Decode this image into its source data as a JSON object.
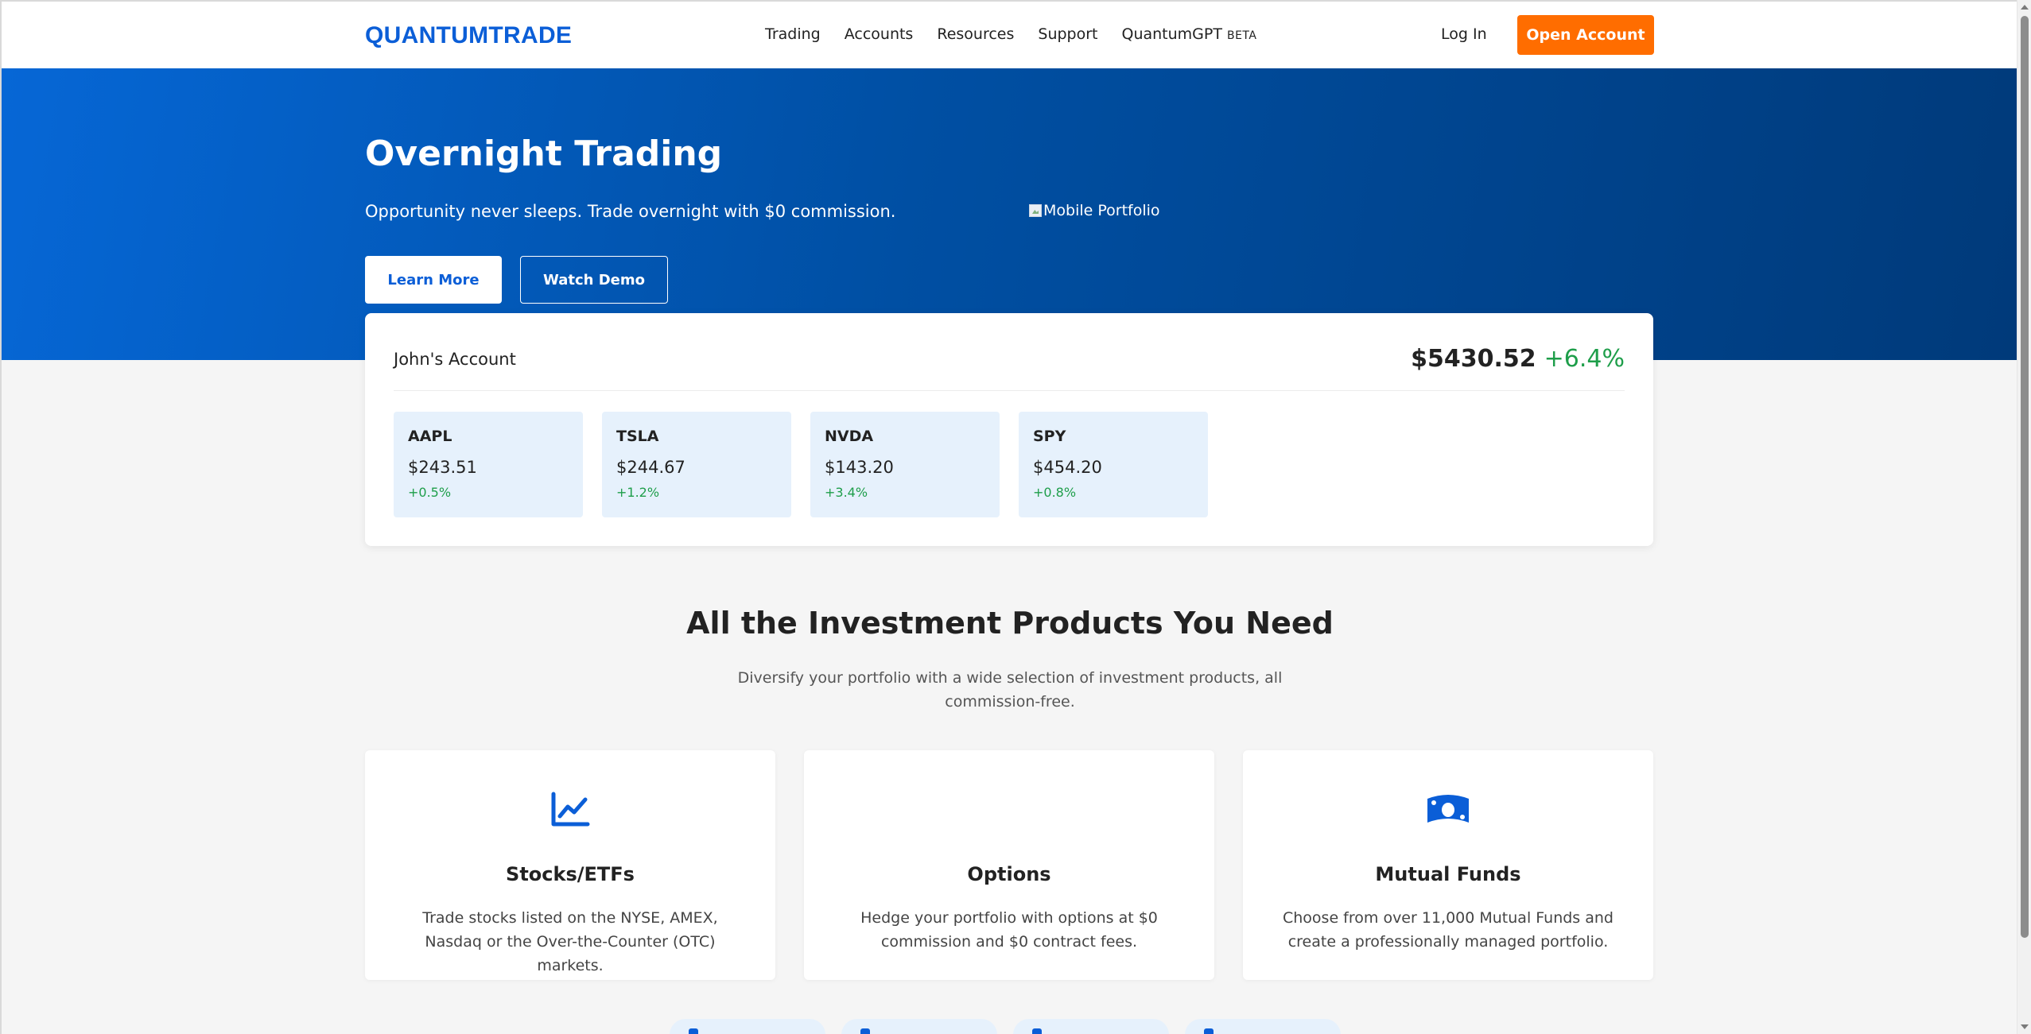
{
  "header": {
    "logo": "QUANTUMTRADE",
    "nav": [
      {
        "label": "Trading"
      },
      {
        "label": "Accounts"
      },
      {
        "label": "Resources"
      },
      {
        "label": "Support"
      },
      {
        "label": "QuantumGPT",
        "badge": "BETA"
      }
    ],
    "login_label": "Log In",
    "open_account_label": "Open Account"
  },
  "hero": {
    "title": "Overnight Trading",
    "subtitle": "Opportunity never sleeps. Trade overnight with $0 commission.",
    "learn_more_label": "Learn More",
    "watch_demo_label": "Watch Demo",
    "image_alt": "Mobile Portfolio"
  },
  "account": {
    "name": "John's Account",
    "value": "$5430.52",
    "change": "+6.4%",
    "tickers": [
      {
        "symbol": "AAPL",
        "price": "$243.51",
        "change": "+0.5%"
      },
      {
        "symbol": "TSLA",
        "price": "$244.67",
        "change": "+1.2%"
      },
      {
        "symbol": "NVDA",
        "price": "$143.20",
        "change": "+3.4%"
      },
      {
        "symbol": "SPY",
        "price": "$454.20",
        "change": "+0.8%"
      }
    ]
  },
  "products": {
    "title": "All the Investment Products You Need",
    "subtitle": "Diversify your portfolio with a wide selection of investment products, all commission-free.",
    "cards": [
      {
        "icon": "chart-line-icon",
        "title": "Stocks/ETFs",
        "description": "Trade stocks listed on the NYSE, AMEX, Nasdaq or the Over-the-Counter (OTC) markets."
      },
      {
        "icon": "none",
        "title": "Options",
        "description": "Hedge your portfolio with options at $0 commission and $0 contract fees."
      },
      {
        "icon": "money-bill-icon",
        "title": "Mutual Funds",
        "description": "Choose from over 11,000 Mutual Funds and create a professionally managed portfolio."
      }
    ]
  },
  "colors": {
    "brand_blue": "#0b5ed7",
    "accent_orange": "#ff6d00",
    "positive_green": "#1e9e4a"
  }
}
